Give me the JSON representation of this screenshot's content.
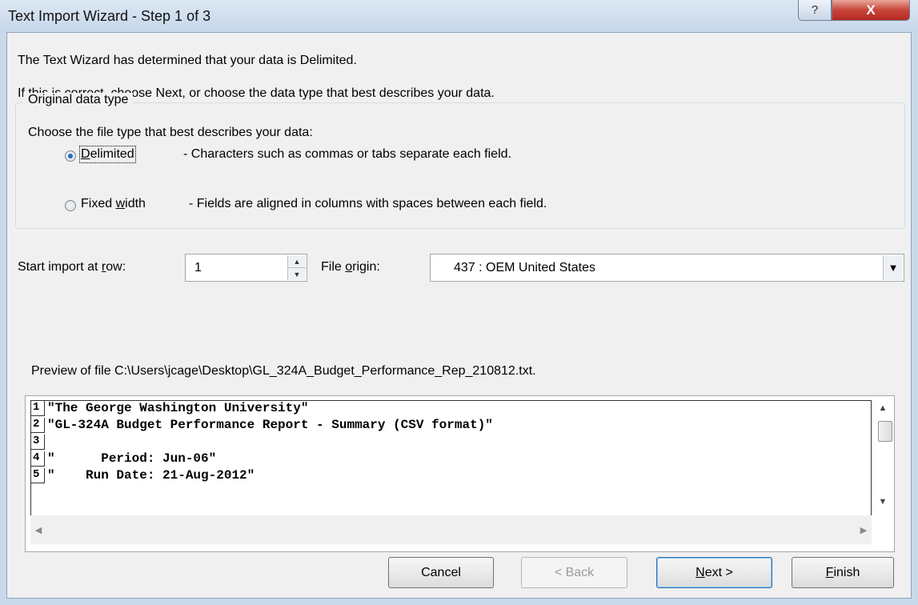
{
  "window": {
    "title": "Text Import Wizard - Step 1 of 3",
    "help_label": "?",
    "close_label": "X"
  },
  "intro": {
    "line1": "The Text Wizard has determined that your data is Delimited.",
    "line2": "If this is correct, choose Next, or choose the data type that best describes your data."
  },
  "original_data_type": {
    "group_title": "Original data type",
    "prompt": "Choose the file type that best describes your data:",
    "options": [
      {
        "label_pre": "",
        "label_ul": "D",
        "label_post": "elimited",
        "description": "- Characters such as commas or tabs separate each field.",
        "selected": true
      },
      {
        "label_pre": "Fixed ",
        "label_ul": "w",
        "label_post": "idth",
        "description": "- Fields are aligned in columns with spaces between each field.",
        "selected": false
      }
    ]
  },
  "start_row": {
    "label_pre": "Start import at ",
    "label_ul": "r",
    "label_post": "ow:",
    "value": "1"
  },
  "file_origin": {
    "label_pre": "File ",
    "label_ul": "o",
    "label_post": "rigin:",
    "value": "437 : OEM United States"
  },
  "preview": {
    "label": "Preview of file C:\\Users\\jcage\\Desktop\\GL_324A_Budget_Performance_Rep_210812.txt.",
    "rows": [
      {
        "num": "1",
        "text": "\"The George Washington University\""
      },
      {
        "num": "2",
        "text": "\"GL-324A Budget Performance Report - Summary (CSV format)\""
      },
      {
        "num": "3",
        "text": ""
      },
      {
        "num": "4",
        "text": "\"      Period: Jun-06\""
      },
      {
        "num": "5",
        "text": "\"    Run Date: 21-Aug-2012\""
      }
    ]
  },
  "buttons": {
    "cancel": "Cancel",
    "back": "< Back",
    "next_ul": "N",
    "next_post": "ext >",
    "finish_ul": "F",
    "finish_post": "inish"
  },
  "colors": {
    "accent": "#2b6fb5",
    "close_button": "#c8453a"
  }
}
